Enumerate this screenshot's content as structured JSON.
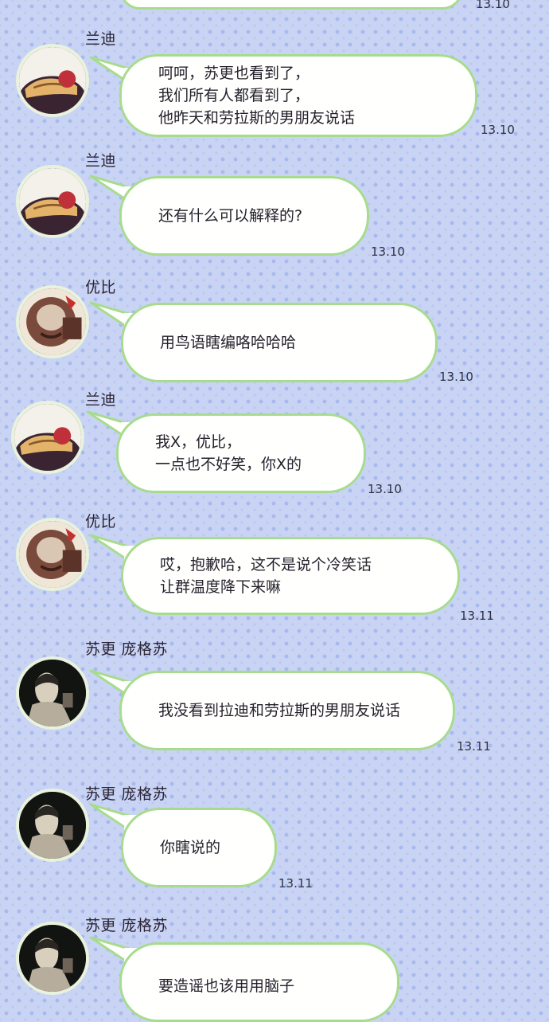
{
  "colors": {
    "background": "#c9d4f4",
    "bubble_fill": "#fffffe",
    "bubble_border": "#a7dc8e",
    "text": "#26212c"
  },
  "messages": [
    {
      "sender": "",
      "text": "",
      "time": "13.10"
    },
    {
      "sender": "兰迪",
      "text": "呵呵，苏更也看到了，\n我们所有人都看到了，\n他昨天和劳拉斯的男朋友说话",
      "time": "13.10",
      "avatar": "randy-avatar"
    },
    {
      "sender": "兰迪",
      "text": "还有什么可以解释的?",
      "time": "13.10",
      "avatar": "randy-avatar"
    },
    {
      "sender": "优比",
      "text": "用鸟语瞎编咯哈哈哈",
      "time": "13.10",
      "avatar": "yoobi-avatar"
    },
    {
      "sender": "兰迪",
      "text": "我X，优比，\n一点也不好笑，你X的",
      "time": "13.10",
      "avatar": "randy-avatar"
    },
    {
      "sender": "优比",
      "text": "哎，抱歉哈，这不是说个冷笑话\n让群温度降下来嘛",
      "time": "13.11",
      "avatar": "yoobi-avatar"
    },
    {
      "sender": "苏更 庞格苏",
      "text": "我没看到拉迪和劳拉斯的男朋友说话",
      "time": "13.11",
      "avatar": "sugeng-avatar"
    },
    {
      "sender": "苏更 庞格苏",
      "text": "你瞎说的",
      "time": "13.11",
      "avatar": "sugeng-avatar"
    },
    {
      "sender": "苏更 庞格苏",
      "text": "要造谣也该用用脑子",
      "time": "",
      "avatar": "sugeng-avatar"
    }
  ]
}
